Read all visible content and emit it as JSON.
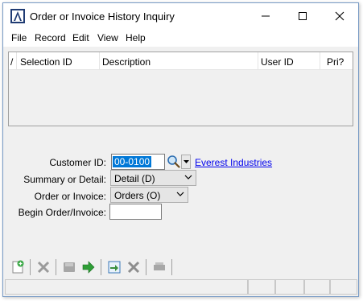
{
  "window": {
    "title": "Order or Invoice History Inquiry"
  },
  "menu": {
    "items": [
      "File",
      "Record",
      "Edit",
      "View",
      "Help"
    ]
  },
  "grid": {
    "columns": [
      {
        "label": "/"
      },
      {
        "label": "Selection ID"
      },
      {
        "label": "Description"
      },
      {
        "label": "User ID"
      },
      {
        "label": "Pri?"
      }
    ]
  },
  "form": {
    "customer_id": {
      "label": "Customer ID:",
      "value": "00-0100",
      "customer_name": "Everest Industries"
    },
    "summary_or_detail": {
      "label": "Summary or Detail:",
      "value": "Detail (D)"
    },
    "order_or_invoice": {
      "label": "Order or Invoice:",
      "value": "Orders (O)"
    },
    "begin_order_invoice": {
      "label": "Begin Order/Invoice:",
      "value": ""
    }
  },
  "toolbar": {
    "icons": [
      "new-icon",
      "delete-icon",
      "save-icon",
      "next-icon",
      "import-icon",
      "tools-icon",
      "print-icon"
    ]
  },
  "colors": {
    "accent": "#0078d7",
    "link": "#0000ee",
    "titlebar": "#ffffff",
    "background": "#f0f0f0"
  }
}
